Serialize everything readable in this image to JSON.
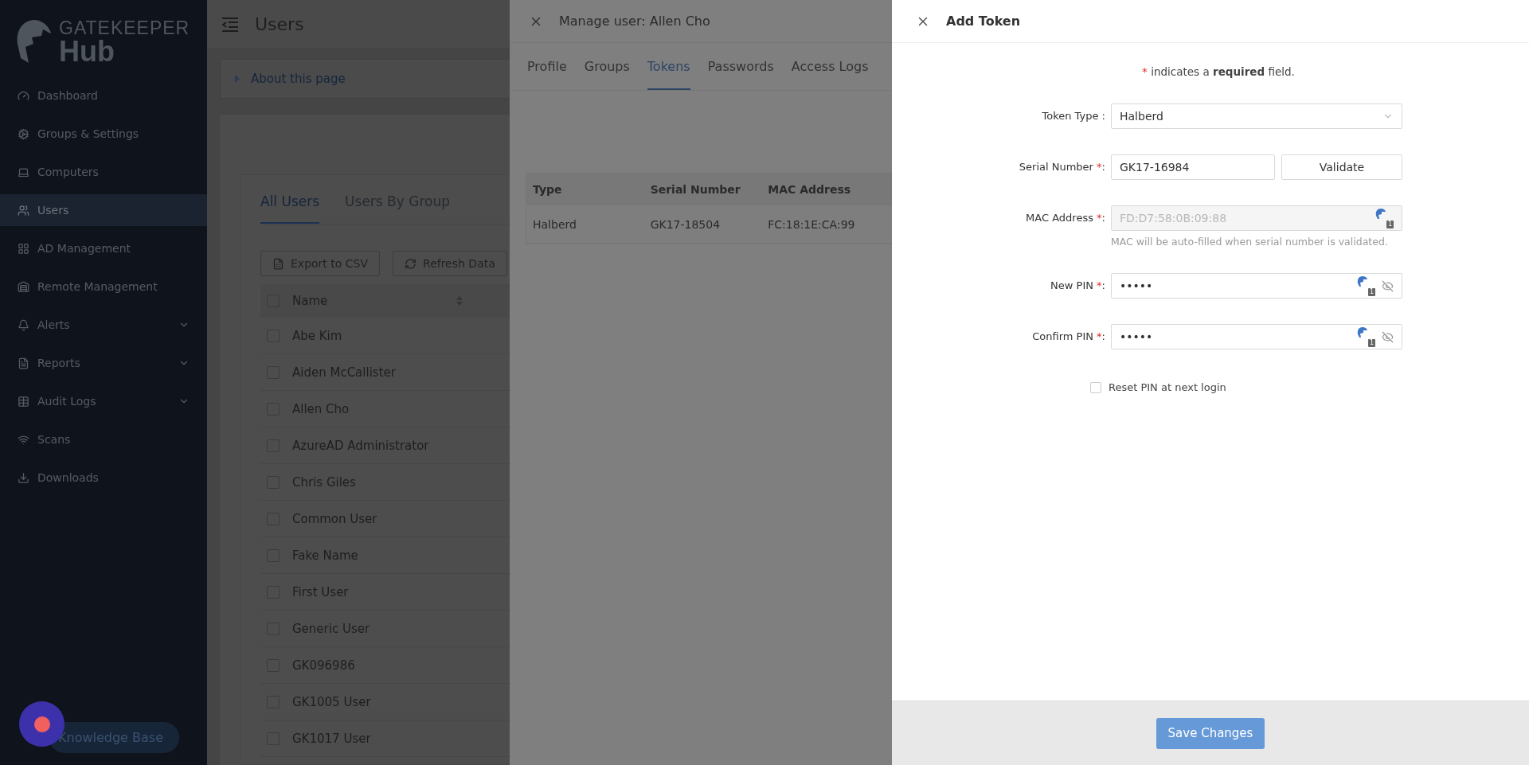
{
  "logo": {
    "top": "GATEKEEPER",
    "bottom": "Hub"
  },
  "sidebar": {
    "items": [
      {
        "label": "Dashboard",
        "selected": false,
        "has_submenu": false
      },
      {
        "label": "Groups & Settings",
        "selected": false,
        "has_submenu": false
      },
      {
        "label": "Computers",
        "selected": false,
        "has_submenu": false
      },
      {
        "label": "Users",
        "selected": true,
        "has_submenu": false
      },
      {
        "label": "AD Management",
        "selected": false,
        "has_submenu": false
      },
      {
        "label": "Remote Management",
        "selected": false,
        "has_submenu": false
      },
      {
        "label": "Alerts",
        "selected": false,
        "has_submenu": true
      },
      {
        "label": "Reports",
        "selected": false,
        "has_submenu": true
      },
      {
        "label": "Audit Logs",
        "selected": false,
        "has_submenu": true
      },
      {
        "label": "Scans",
        "selected": false,
        "has_submenu": false
      },
      {
        "label": "Downloads",
        "selected": false,
        "has_submenu": false
      }
    ],
    "knowledge_base": "Knowledge Base"
  },
  "page": {
    "title": "Users",
    "about": "About this page",
    "tabs": [
      {
        "label": "All Users",
        "selected": true
      },
      {
        "label": "Users By Group",
        "selected": false
      }
    ],
    "buttons": [
      {
        "label": "Export to CSV"
      },
      {
        "label": "Refresh Data"
      }
    ],
    "table": {
      "column": "Name",
      "select_all_checked": false,
      "rows": [
        {
          "name": "Abe Kim",
          "checked": false
        },
        {
          "name": "Aiden McCallister",
          "checked": false
        },
        {
          "name": "Allen Cho",
          "checked": false
        },
        {
          "name": "AzureAD Administrator",
          "checked": false
        },
        {
          "name": "Chris Giles",
          "checked": false
        },
        {
          "name": "Common User",
          "checked": false
        },
        {
          "name": "Fake Name",
          "checked": false
        },
        {
          "name": "First User",
          "checked": false
        },
        {
          "name": "Generic User",
          "checked": false
        },
        {
          "name": "GK096986",
          "checked": false
        },
        {
          "name": "GK1005 User",
          "checked": false
        },
        {
          "name": "GK1017 User",
          "checked": false
        }
      ]
    }
  },
  "manage_drawer": {
    "title": "Manage user: Allen Cho",
    "tabs": [
      {
        "label": "Profile",
        "selected": false
      },
      {
        "label": "Groups",
        "selected": false
      },
      {
        "label": "Tokens",
        "selected": true
      },
      {
        "label": "Passwords",
        "selected": false
      },
      {
        "label": "Access Logs",
        "selected": false
      }
    ],
    "table": {
      "columns": [
        "Type",
        "Serial Number",
        "MAC Address"
      ],
      "rows": [
        [
          "Halberd",
          "GK17-18504",
          "FC:18:1E:CA:99"
        ]
      ]
    }
  },
  "add_token": {
    "title": "Add Token",
    "required_mark": "*",
    "label_suffix": ":",
    "note": "indicates a **required** field.",
    "fields": [
      {
        "kind": "select",
        "label": "Token Type",
        "value": "Halberd",
        "required": false
      },
      {
        "kind": "text",
        "label": "Serial Number",
        "value": "GK17-16984",
        "required": true,
        "button": "Validate"
      },
      {
        "kind": "text",
        "label": "MAC Address",
        "value": "FD:D7:58:0B:09:88",
        "required": true,
        "disabled": true,
        "extension_badge": "1",
        "help": "MAC will be auto-filled when serial number is validated."
      },
      {
        "kind": "password",
        "label": "New PIN",
        "value": "•••••",
        "required": true,
        "extension_badge": "1"
      },
      {
        "kind": "password",
        "label": "Confirm PIN",
        "value": "•••••",
        "required": true,
        "extension_badge": "1"
      }
    ],
    "checkbox": {
      "label": "Reset PIN at next login",
      "checked": false
    },
    "save": "Save Changes"
  }
}
